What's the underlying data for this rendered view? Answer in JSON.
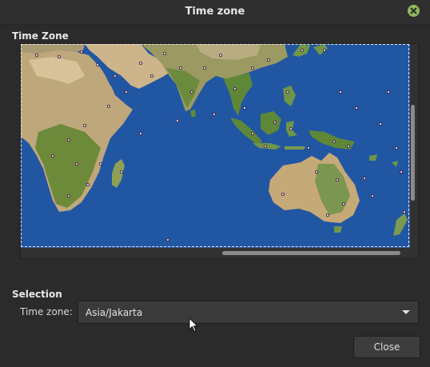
{
  "window": {
    "title": "Time zone"
  },
  "map_section": {
    "heading": "Time Zone"
  },
  "selection": {
    "heading": "Selection",
    "timezone_label": "Time zone:",
    "timezone_value": "Asia/Jakarta"
  },
  "buttons": {
    "close_label": "Close"
  },
  "colors": {
    "ocean": "#2156a3",
    "window_bg": "#2b2b2b",
    "close_icon": "#8fba5b"
  },
  "icons": {
    "window_close": "close-icon",
    "dropdown": "chevron-down-icon",
    "pointer": "mouse-cursor"
  }
}
